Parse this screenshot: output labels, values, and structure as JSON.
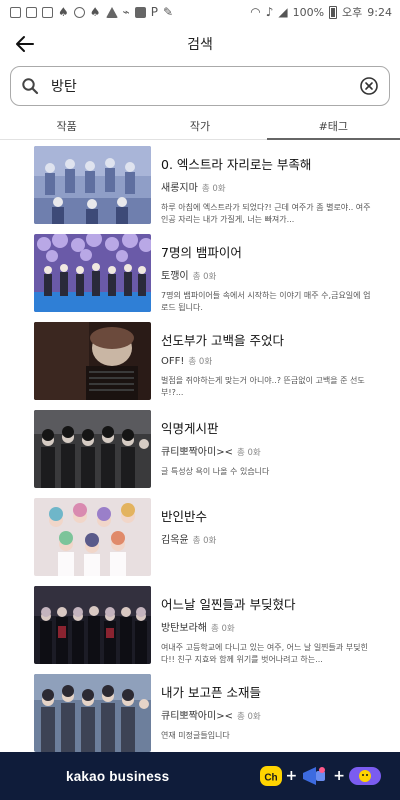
{
  "status_bar": {
    "battery": "100%",
    "ampm": "오후",
    "time": "9:24"
  },
  "header": {
    "title": "검색"
  },
  "search": {
    "value": "방탄"
  },
  "tabs": [
    {
      "label": "작품",
      "active": false
    },
    {
      "label": "작가",
      "active": false
    },
    {
      "label": "#태그",
      "active": true
    }
  ],
  "results": [
    {
      "title": "0. 엑스트라 자리로는 부족해",
      "author": "새롱지마",
      "count": "총 0화",
      "desc": "하루 아침에 엑스트라가 되었다?! 근데 여주가 좀 별로야.. 여주인공 자리는 내가 가질게, 너는 빠져가..."
    },
    {
      "title": "7명의 뱀파이어",
      "author": "토깽이",
      "count": "총 0화",
      "desc": "7명의 뱀파이어들 속에서 시작하는 이야기 매주 수,금요일에 업로드 됩니다."
    },
    {
      "title": "선도부가 고백을 주었다",
      "author": "OFF!",
      "count": "총 0화",
      "desc": "벌점을 쥐야하는게 맞는거 아니야..? 뜬금없이 고백을 준 선도부!?..."
    },
    {
      "title": "익명게시판",
      "author": "큐티뽀짝아미><",
      "count": "총 0화",
      "desc": "글 특성상 욕이 나올 수 있습니다"
    },
    {
      "title": "반인반수",
      "author": "김옥윤",
      "count": "총 0화",
      "desc": ""
    },
    {
      "title": "어느날 일찐들과 부딪혔다",
      "author": "방탄보라해",
      "count": "총 0화",
      "desc": "여내주 고등학교에 다니고 있는 여주, 어느 날 일찐들과 부딪힌다!! 친구 지효와 함께 위기를 벗어나려고 하는..."
    },
    {
      "title": "내가 보고픈 소재들",
      "author": "큐티뽀짝아미><",
      "count": "총 0화",
      "desc": "연재 미정글들입니다"
    }
  ],
  "ad": {
    "brand": "kakao business",
    "icon_ch_label": "Ch",
    "plus": "+"
  }
}
